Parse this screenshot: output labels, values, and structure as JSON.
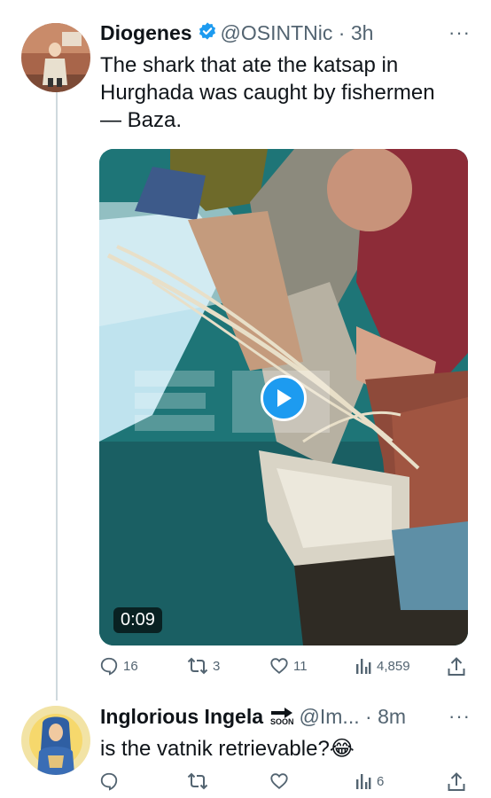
{
  "tweet": {
    "author_name": "Diogenes",
    "handle": "@OSINTNic",
    "time": "3h",
    "more_label": "···",
    "text_lines": [
      "The shark that ate the katsap in",
      "Hurghada was caught by fishermen",
      "— Baza."
    ],
    "media": {
      "duration": "0:09"
    },
    "stats": {
      "replies": "16",
      "retweets": "3",
      "likes": "11",
      "views": "4,859"
    }
  },
  "reply": {
    "author_name": "Inglorious Ingela",
    "badge_text": "SOON",
    "handle": "@Im...",
    "time": "8m",
    "more_label": "···",
    "text": "is the vatnik retrievable?😂",
    "stats": {
      "views": "6"
    }
  },
  "colors": {
    "verified": "#1d9bf0",
    "secondary_text": "#536471",
    "thread_line": "#cfd9de"
  }
}
